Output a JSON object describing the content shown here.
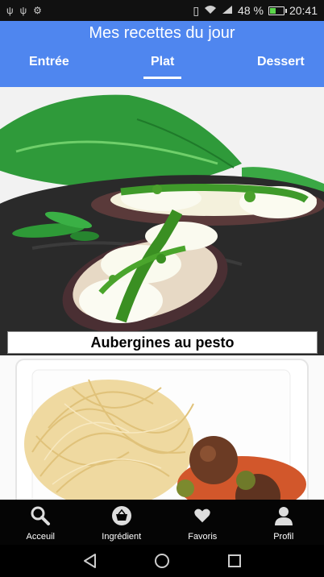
{
  "status_bar": {
    "battery_percent": "48 %",
    "time": "20:41",
    "battery_level": 0.48
  },
  "header": {
    "title": "Mes recettes du jour",
    "tabs": [
      {
        "label": "Entrée"
      },
      {
        "label": "Plat"
      },
      {
        "label": "Dessert"
      }
    ],
    "active_tab": "Plat"
  },
  "recipes": [
    {
      "name": "Aubergines au pesto"
    },
    {
      "name": ""
    }
  ],
  "bottom_nav": {
    "items": [
      {
        "label": "Acceuil",
        "icon": "search-icon"
      },
      {
        "label": "Ingrédient",
        "icon": "basket-icon"
      },
      {
        "label": "Favoris",
        "icon": "heart-icon"
      },
      {
        "label": "Profil",
        "icon": "user-icon"
      }
    ]
  },
  "colors": {
    "header_bg": "#4f86ef",
    "nav_bg": "#050505"
  }
}
